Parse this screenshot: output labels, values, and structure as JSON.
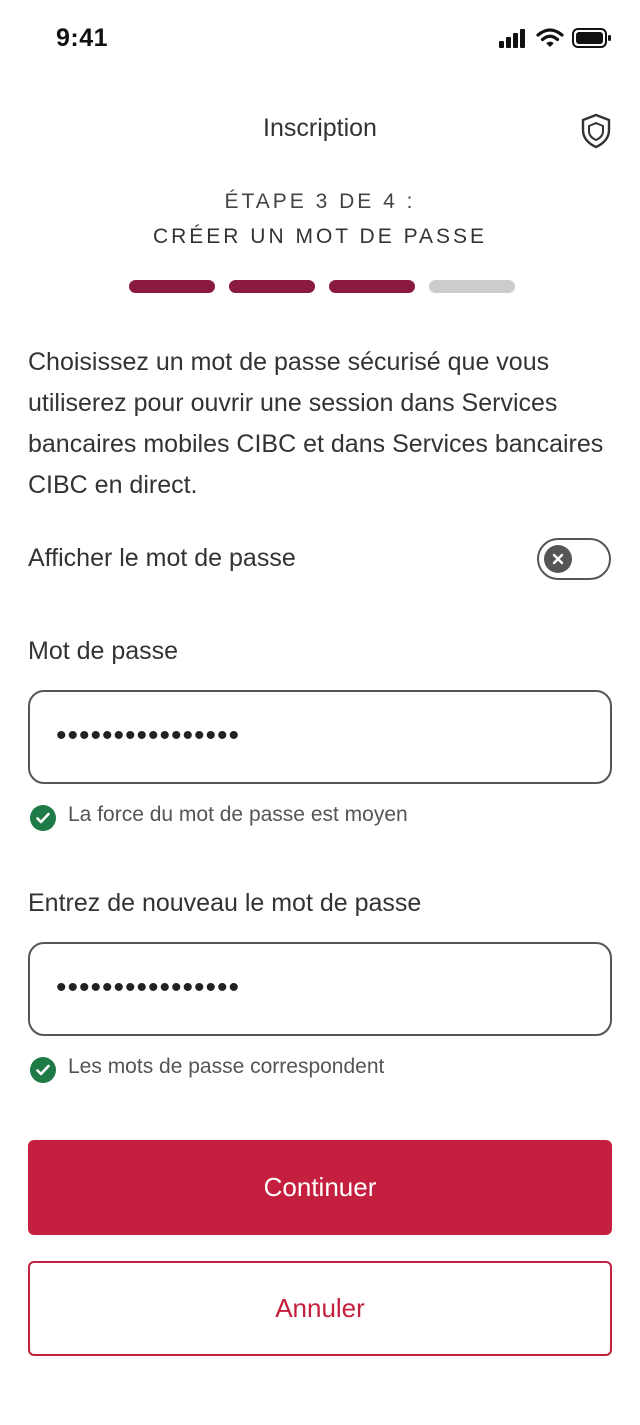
{
  "status_bar": {
    "time": "9:41",
    "icons": [
      "cellular-signal-icon",
      "wifi-icon",
      "battery-icon"
    ]
  },
  "header": {
    "title": "Inscription",
    "icon": "shield-icon"
  },
  "step": {
    "line1": "ÉTAPE 3 DE 4 :",
    "line2": "CRÉER UN MOT DE PASSE",
    "current": 3,
    "total": 4
  },
  "intro": "Choisissez un mot de passe sécurisé que vous utiliserez pour ouvrir une session dans Services bancaires mobiles CIBC et dans Services bancaires CIBC en direct.",
  "show_password": {
    "label": "Afficher le mot de passe",
    "enabled": false
  },
  "password": {
    "label": "Mot de passe",
    "value": "••••••••••••••••",
    "hint": "La force du mot de passe est moyen"
  },
  "confirm": {
    "label": "Entrez de nouveau le mot de passe",
    "value": "••••••••••••••••",
    "hint": "Les mots de passe correspondent"
  },
  "buttons": {
    "continue": "Continuer",
    "cancel": "Annuler"
  },
  "colors": {
    "brand": "#c41f3e",
    "progress_active": "#8b1a42",
    "progress_inactive": "#cccccc",
    "success": "#1e7a46"
  }
}
